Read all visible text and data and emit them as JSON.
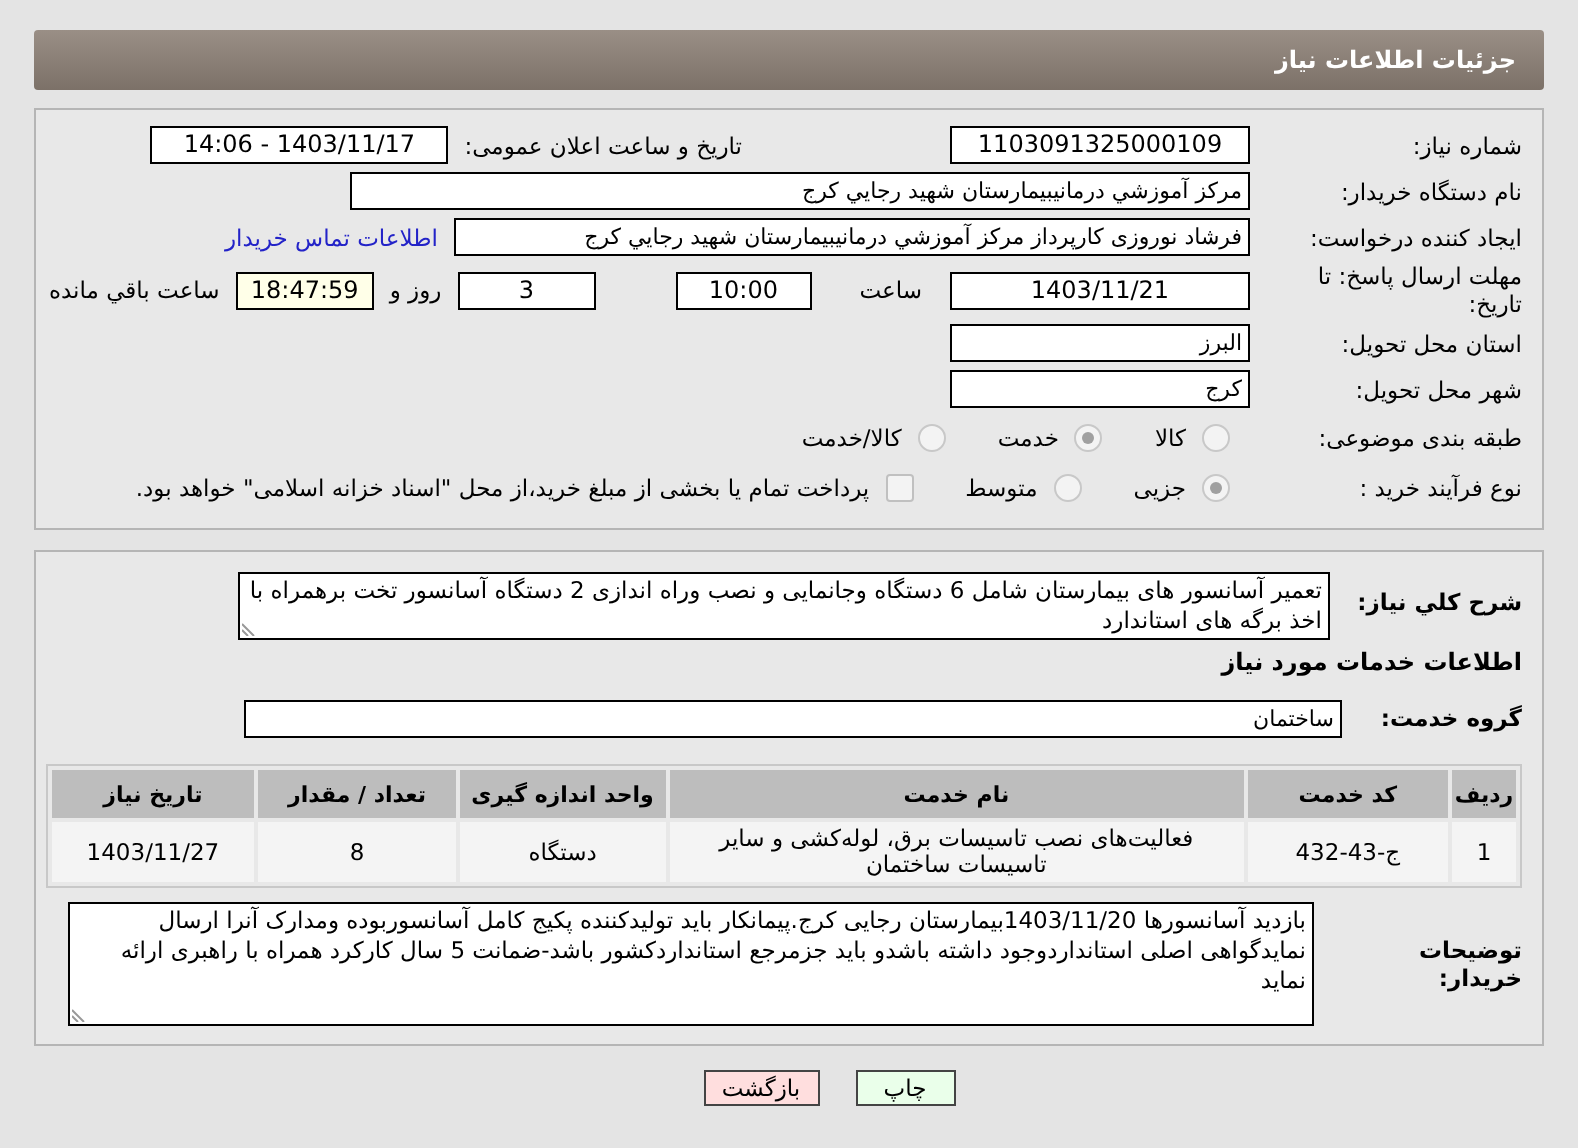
{
  "header": {
    "title": "جزئیات اطلاعات نیاز"
  },
  "need_number": {
    "label": "شماره نیاز:",
    "value": "1103091325000109"
  },
  "announce": {
    "label": "تاریخ و ساعت اعلان عمومی:",
    "value": "1403/11/17 - 14:06"
  },
  "buyer_org": {
    "label": "نام دستگاه خریدار:",
    "value": "مرکز آموزشي درمانيبيمارستان شهيد رجايي کرج"
  },
  "requester": {
    "label": "ایجاد کننده درخواست:",
    "value": "فرشاد نوروزی کارپرداز مرکز آموزشي درمانيبيمارستان شهيد رجايي کرج",
    "link": "اطلاعات تماس خریدار"
  },
  "deadline": {
    "label": "مهلت ارسال پاسخ: تا تاریخ:",
    "date": "1403/11/21",
    "time_label": "ساعت",
    "time": "10:00",
    "days": "3",
    "days_label": "روز و",
    "remaining": "18:47:59",
    "remaining_label": "ساعت باقي مانده"
  },
  "province": {
    "label": "استان محل تحویل:",
    "value": "البرز"
  },
  "city": {
    "label": "شهر محل تحویل:",
    "value": "کرج"
  },
  "category": {
    "label": "طبقه بندی موضوعی:",
    "options": [
      {
        "label": "کالا",
        "selected": false
      },
      {
        "label": "خدمت",
        "selected": true
      },
      {
        "label": "کالا/خدمت",
        "selected": false
      }
    ]
  },
  "purchase_type": {
    "label": "نوع فرآیند خرید :",
    "options": [
      {
        "label": "جزیی",
        "selected": true
      },
      {
        "label": "متوسط",
        "selected": false
      }
    ],
    "treasury": {
      "checked": false,
      "label": "پرداخت تمام یا بخشی از مبلغ خرید،از محل \"اسناد خزانه اسلامی\" خواهد بود."
    }
  },
  "description": {
    "label": "شرح کلي نیاز:",
    "value": "تعمیر آسانسور های بیمارستان شامل  6 دستگاه وجانمایی و نصب وراه اندازی 2 دستگاه آسانسور تخت برهمراه با  اخذ برگه های استاندارد"
  },
  "services_heading": "اطلاعات خدمات مورد نیاز",
  "service_group": {
    "label": "گروه خدمت:",
    "value": "ساختمان"
  },
  "table": {
    "columns": [
      "ردیف",
      "کد خدمت",
      "نام خدمت",
      "واحد اندازه گیری",
      "تعداد / مقدار",
      "تاریخ نیاز"
    ],
    "rows": [
      [
        "1",
        "ج-43-432",
        "فعالیت‌های نصب تاسیسات برق، لوله‌کشی و سایر تاسیسات ساختمان",
        "دستگاه",
        "8",
        "1403/11/27"
      ]
    ]
  },
  "buyer_notes": {
    "label": "توضیحات خریدار:",
    "value": "بازدید آسانسورها 1403/11/20بیمارستان رجایی کرج.پیمانکار باید تولیدکننده پکیج کامل آسانسوربوده ومدارک آنرا ارسال نمایدگواهی اصلی استانداردوجود داشته باشدو باید جزمرجع استانداردکشور باشد-ضمانت 5 سال کارکرد همراه با راهبری ارائه نماید"
  },
  "buttons": [
    {
      "label": "چاپ",
      "kind": "print"
    },
    {
      "label": "بازگشت",
      "kind": "back"
    }
  ]
}
